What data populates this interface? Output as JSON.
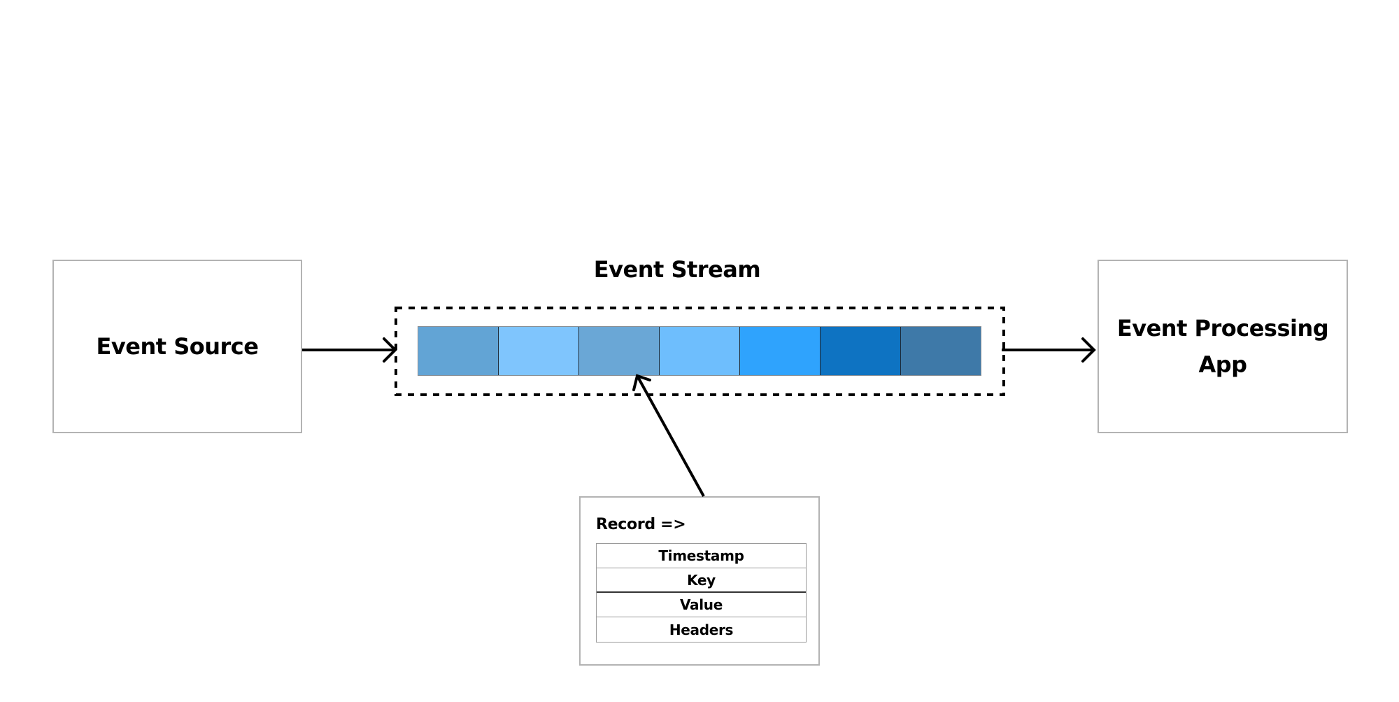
{
  "diagram": {
    "source": {
      "label": "Event Source"
    },
    "stream": {
      "title": "Event Stream",
      "segments": [
        {
          "color": "#62a4d5"
        },
        {
          "color": "#7fc5fd"
        },
        {
          "color": "#6aa7d6"
        },
        {
          "color": "#6ebefd"
        },
        {
          "color": "#2fa3fd"
        },
        {
          "color": "#0e73c2"
        },
        {
          "color": "#3e79a8"
        }
      ]
    },
    "app": {
      "label": "Event Processing App"
    },
    "record": {
      "label": "Record =>",
      "fields": [
        "Timestamp",
        "Key",
        "Value",
        "Headers"
      ]
    },
    "edges": [
      {
        "from": "Event Source",
        "to": "Event Stream"
      },
      {
        "from": "Event Stream",
        "to": "Event Processing App"
      },
      {
        "from": "Record",
        "to": "Event Stream"
      }
    ]
  }
}
